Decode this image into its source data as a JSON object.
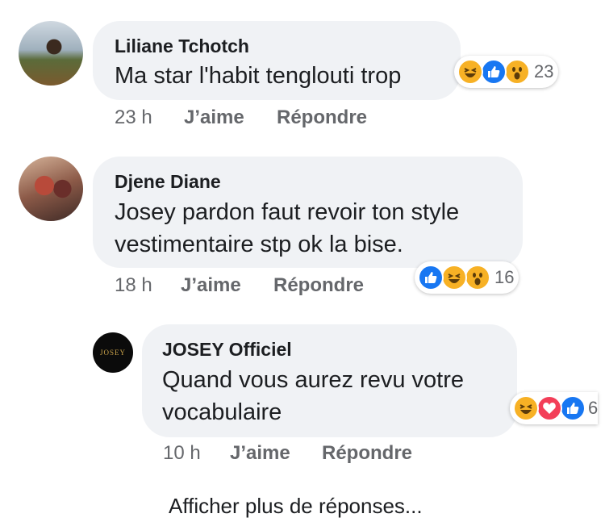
{
  "comments": [
    {
      "author": "Liliane Tchotch",
      "text": "Ma star l'habit tenglouti trop",
      "time": "23 h",
      "like_label": "J’aime",
      "reply_label": "Répondre",
      "reaction_icons": [
        "haha-icon",
        "like-icon",
        "wow-icon"
      ],
      "reaction_count": "23"
    },
    {
      "author": "Djene Diane",
      "text": "Josey pardon faut revoir ton style\nvestimentaire stp ok la bise.",
      "time": "18 h",
      "like_label": "J’aime",
      "reply_label": "Répondre",
      "reaction_icons": [
        "like-icon",
        "haha-icon",
        "wow-icon"
      ],
      "reaction_count": "16"
    },
    {
      "author": "JOSEY Officiel",
      "avatar_text": "JOSEY",
      "text": "Quand vous aurez revu votre\nvocabulaire",
      "time": "10 h",
      "like_label": "J’aime",
      "reply_label": "Répondre",
      "reaction_icons": [
        "haha-icon",
        "love-icon",
        "like-icon"
      ],
      "reaction_count": "6"
    }
  ],
  "more_replies_label": "Afficher plus de réponses...",
  "colors": {
    "like": "#1877f2",
    "love": "#f33e58",
    "haha": "#f7b125",
    "bubble": "#f0f2f5",
    "meta": "#65676b"
  }
}
